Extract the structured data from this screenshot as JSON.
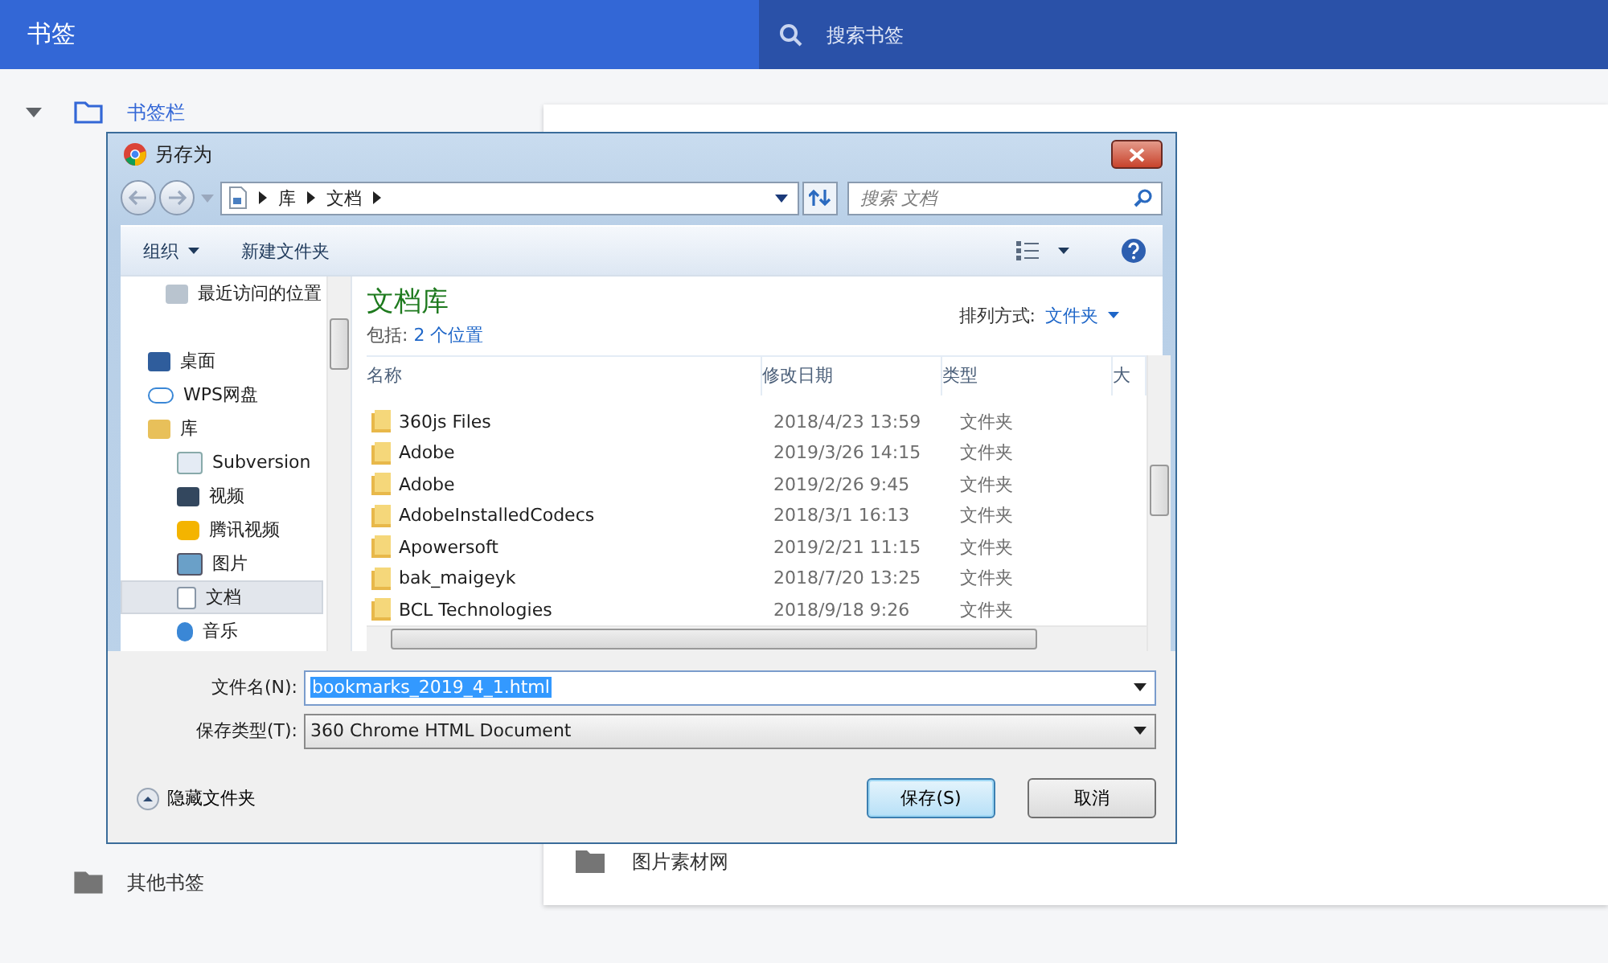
{
  "app": {
    "title": "书签",
    "search": {
      "placeholder": "搜索书签"
    }
  },
  "tree": [
    {
      "label": "书签栏",
      "selected": true,
      "expanded": true
    },
    {
      "label": "其他书签",
      "selected": false
    }
  ],
  "list": [
    {
      "label": "图片素材网"
    }
  ],
  "dialog": {
    "title": "另存为",
    "address": [
      "库",
      "文档"
    ],
    "search": {
      "placeholder": "搜索 文档"
    },
    "toolbar": [
      {
        "label": "组织",
        "kind": "menu"
      },
      {
        "label": "新建文件夹",
        "kind": "button"
      }
    ],
    "nav": [
      {
        "label": "最近访问的位置",
        "selected": false
      },
      {
        "label": "桌面",
        "selected": false
      },
      {
        "label": "WPS网盘",
        "selected": false
      },
      {
        "label": "库",
        "selected": false,
        "children": [
          {
            "label": "Subversion",
            "selected": false
          },
          {
            "label": "视频",
            "selected": false
          },
          {
            "label": "腾讯视频",
            "selected": false
          },
          {
            "label": "图片",
            "selected": false
          },
          {
            "label": "文档",
            "selected": true
          },
          {
            "label": "音乐",
            "selected": false
          }
        ]
      }
    ],
    "library": {
      "title": "文档库",
      "includes_label": "包括:",
      "includes_link": "2 个位置",
      "sort_label": "排列方式:",
      "sort_value": "文件夹"
    },
    "columns": [
      "名称",
      "修改日期",
      "类型",
      "大"
    ],
    "rows": [
      {
        "name": "360js Files",
        "date": "2018/4/23 13:59",
        "type": "文件夹"
      },
      {
        "name": "Adobe",
        "date": "2019/3/26 14:15",
        "type": "文件夹"
      },
      {
        "name": "Adobe",
        "date": "2019/2/26 9:45",
        "type": "文件夹"
      },
      {
        "name": "AdobeInstalledCodecs",
        "date": "2018/3/1 16:13",
        "type": "文件夹"
      },
      {
        "name": "Apowersoft",
        "date": "2019/2/21 11:15",
        "type": "文件夹"
      },
      {
        "name": "bak_maigeyk",
        "date": "2018/7/20 13:25",
        "type": "文件夹"
      },
      {
        "name": "BCL Technologies",
        "date": "2018/9/18 9:26",
        "type": "文件夹"
      }
    ],
    "filename": {
      "label": "文件名(N):",
      "value": "bookmarks_2019_4_1.html"
    },
    "filetype": {
      "label": "保存类型(T):",
      "value": "360 Chrome HTML Document"
    },
    "hide_folders": "隐藏文件夹",
    "buttons": [
      {
        "label": "保存(S)",
        "kind": "primary"
      },
      {
        "label": "取消",
        "kind": "normal"
      }
    ]
  }
}
